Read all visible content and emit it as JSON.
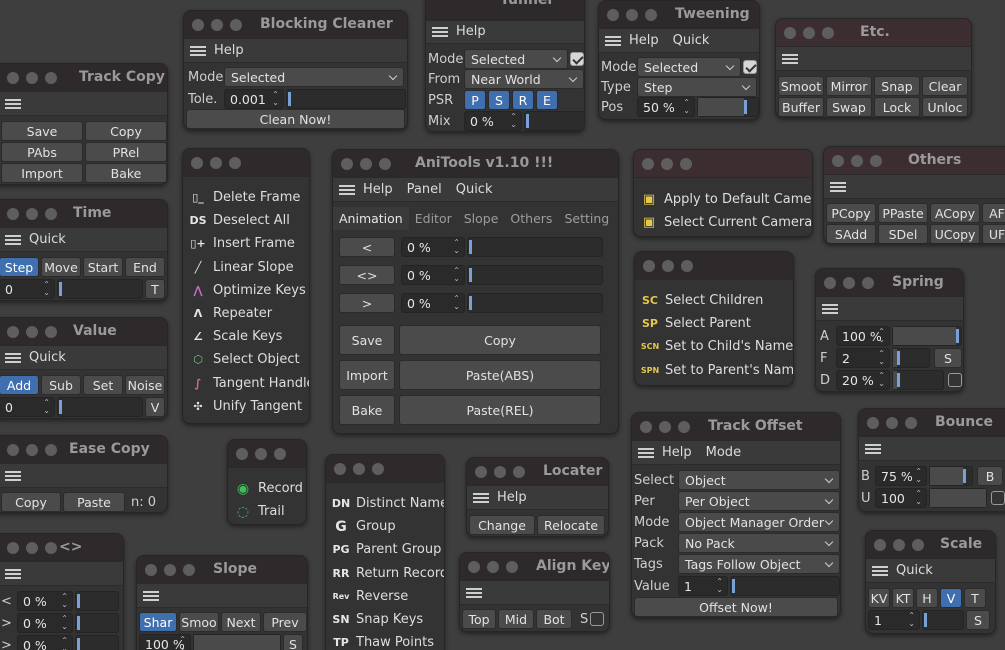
{
  "blocking_cleaner": {
    "title": "Blocking Cleaner",
    "menu_help": "Help",
    "mode_label": "Mode",
    "mode_value": "Selected",
    "tole_label": "Tole.",
    "tole_value": "0.001",
    "clean_btn": "Clean Now!"
  },
  "tunnel": {
    "title": "Tunnel",
    "menu_help": "Help",
    "mode_label": "Mode",
    "mode_value": "Selected",
    "from_label": "From",
    "from_value": "Near World",
    "psr_label": "PSR",
    "psr_buttons": [
      "P",
      "S",
      "R",
      "E"
    ],
    "mix_label": "Mix",
    "mix_value": "0 %"
  },
  "tweening": {
    "title": "Tweening",
    "menu_help": "Help",
    "menu_quick": "Quick",
    "mode_label": "Mode",
    "mode_value": "Selected",
    "type_label": "Type",
    "type_value": "Step",
    "pos_label": "Pos",
    "pos_value": "50 %",
    "pos_level": 0.82
  },
  "etc": {
    "title": "Etc.",
    "buttons": [
      "Smoot",
      "Mirror",
      "Snap",
      "Clear",
      "Buffer",
      "Swap",
      "Lock",
      "Unloc"
    ]
  },
  "track_copy": {
    "title": "Track Copy",
    "buttons": [
      "Save",
      "Copy",
      "PAbs",
      "PRel",
      "Import",
      "Bake"
    ]
  },
  "time": {
    "title": "Time",
    "menu_quick": "Quick",
    "buttons": [
      "Step",
      "Move",
      "Start",
      "End"
    ],
    "value": "0",
    "t_btn": "T"
  },
  "value_win": {
    "title": "Value",
    "menu_quick": "Quick",
    "buttons": [
      "Add",
      "Sub",
      "Set",
      "Noise"
    ],
    "value": "0",
    "v_btn": "V"
  },
  "ease_copy": {
    "title": "Ease Copy",
    "copy_btn": "Copy",
    "paste_btn": "Paste",
    "n_label": "n: 0"
  },
  "arrow_win": {
    "title": "<>",
    "rows": [
      {
        "label": "<",
        "value": "0 %"
      },
      {
        "label": ">",
        "value": "0 %"
      },
      {
        "label": ">",
        "value": "0 %"
      }
    ]
  },
  "slope": {
    "title": "Slope",
    "buttons": [
      "Shar",
      "Smoo",
      "Next",
      "Prev"
    ],
    "value": "100 %",
    "s_btn": "S"
  },
  "key_tools": {
    "items": [
      {
        "icon": "▯_",
        "label": "Delete Frame"
      },
      {
        "icon": "DS",
        "label": "Deselect All"
      },
      {
        "icon": "▯+",
        "label": "Insert Frame"
      },
      {
        "icon": "╱",
        "label": "Linear Slope"
      },
      {
        "icon": "⋀",
        "label": "Optimize Keys"
      },
      {
        "icon": "Ʌ",
        "label": "Repeater"
      },
      {
        "icon": "∠",
        "label": "Scale Keys"
      },
      {
        "icon": "⬡",
        "label": "Select Object"
      },
      {
        "icon": "∫",
        "label": "Tangent Handle"
      },
      {
        "icon": "✣",
        "label": "Unify Tangent"
      }
    ]
  },
  "record": {
    "items": [
      "Record",
      "Trail"
    ]
  },
  "anitools": {
    "title": "AniTools v1.10 !!!",
    "menu": [
      "Help",
      "Panel",
      "Quick"
    ],
    "tabs": [
      "Animation",
      "Editor",
      "Slope",
      "Others",
      "Setting"
    ],
    "rows": [
      {
        "btn": "<",
        "value": "0 %"
      },
      {
        "btn": "<>",
        "value": "0 %"
      },
      {
        "btn": ">",
        "value": "0 %"
      }
    ],
    "actions": [
      {
        "left": "Save",
        "right": "Copy"
      },
      {
        "left": "Import",
        "right": "Paste(ABS)"
      },
      {
        "left": "Bake",
        "right": "Paste(REL)"
      }
    ]
  },
  "naming": {
    "items": [
      {
        "icon": "DN",
        "label": "Distinct Name"
      },
      {
        "icon": "G",
        "label": "Group"
      },
      {
        "icon": "PG",
        "label": "Parent Group"
      },
      {
        "icon": "RR",
        "label": "Return Record"
      },
      {
        "icon": "Rev",
        "label": "Reverse"
      },
      {
        "icon": "SN",
        "label": "Snap Keys"
      },
      {
        "icon": "TP",
        "label": "Thaw Points"
      }
    ]
  },
  "locater": {
    "title": "Locater",
    "menu_help": "Help",
    "change_btn": "Change",
    "relocate_btn": "Relocate"
  },
  "align_key": {
    "title": "Align Key",
    "buttons": [
      "Top",
      "Mid",
      "Bot"
    ],
    "s_label": "S"
  },
  "camera": {
    "items": [
      "Apply to Default Camera",
      "Select Current Camera"
    ]
  },
  "hierarchy": {
    "items": [
      {
        "icon": "SC",
        "label": "Select Children"
      },
      {
        "icon": "SP",
        "label": "Select Parent"
      },
      {
        "icon": "SCN",
        "label": "Set to Child's Name"
      },
      {
        "icon": "SPN",
        "label": "Set to Parent's Name"
      }
    ]
  },
  "others": {
    "title": "Others",
    "buttons": [
      "PCopy",
      "PPaste",
      "ACopy",
      "AF",
      "SAdd",
      "SDel",
      "UCopy",
      "UF"
    ]
  },
  "spring": {
    "title": "Spring",
    "rows": [
      {
        "label": "A",
        "value": "100 %",
        "level": 0.98
      },
      {
        "label": "F",
        "value": "2",
        "level": 0.12
      },
      {
        "label": "D",
        "value": "20 %",
        "level": 0.08
      }
    ],
    "s_btn": "S"
  },
  "track_offset": {
    "title": "Track Offset",
    "menu": [
      "Help",
      "Mode"
    ],
    "rows": [
      {
        "label": "Select",
        "value": "Object"
      },
      {
        "label": "Per",
        "value": "Per Object"
      },
      {
        "label": "Mode",
        "value": "Object Manager Order"
      },
      {
        "label": "Pack",
        "value": "No Pack"
      },
      {
        "label": "Tags",
        "value": "Tags Follow Object"
      }
    ],
    "value_label": "Value",
    "value_value": "1",
    "offset_btn": "Offset Now!"
  },
  "bounce": {
    "title": "Bounce",
    "b_label": "B",
    "b_value": "75 %",
    "b_btn": "B",
    "u_label": "U",
    "u_value": "100"
  },
  "scale": {
    "title": "Scale",
    "menu_quick": "Quick",
    "buttons": [
      "KV",
      "KT",
      "H",
      "V",
      "T"
    ],
    "value": "1",
    "s_btn": "S"
  }
}
